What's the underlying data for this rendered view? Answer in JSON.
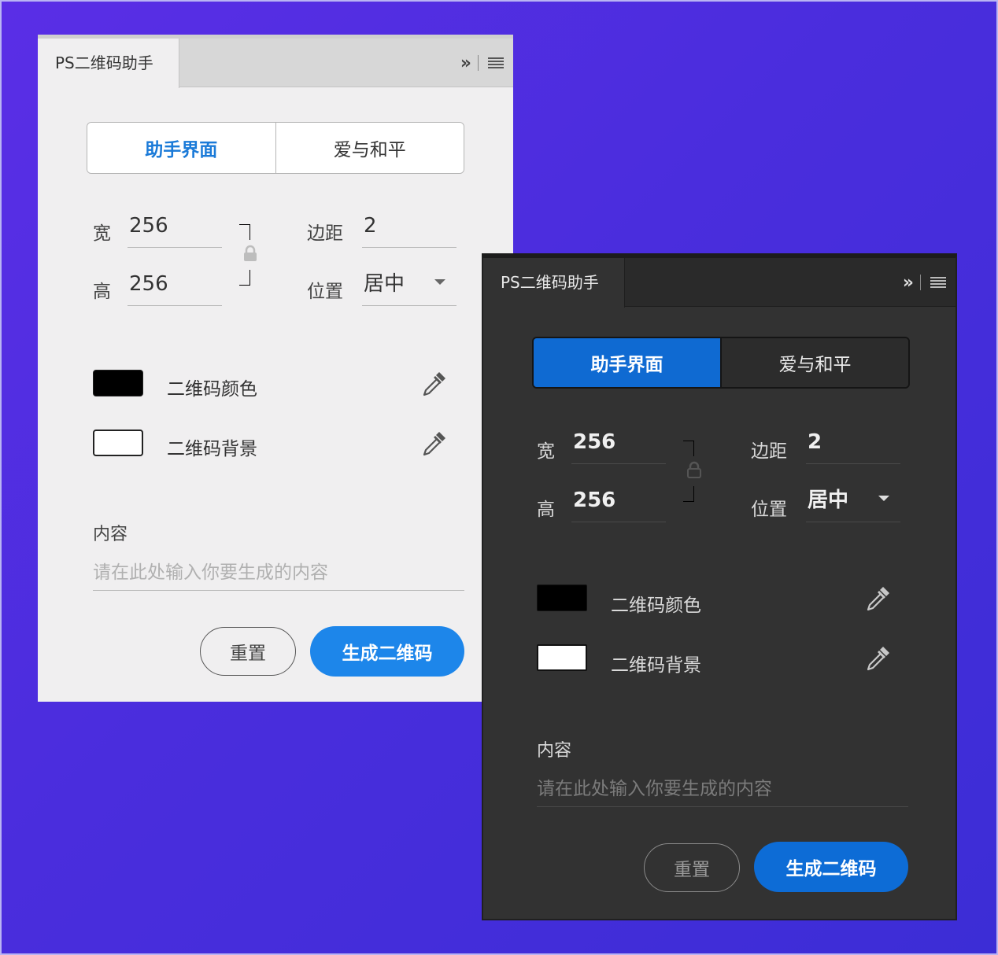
{
  "panels": {
    "light": {
      "tab_title": "PS二维码助手",
      "collapse_glyph": "››",
      "segment": {
        "active": "助手界面",
        "inactive": "爱与和平"
      },
      "width_label": "宽",
      "width_value": "256",
      "height_label": "高",
      "height_value": "256",
      "margin_label": "边距",
      "margin_value": "2",
      "position_label": "位置",
      "position_value": "居中",
      "color_label": "二维码颜色",
      "bg_label": "二维码背景",
      "content_label": "内容",
      "content_placeholder": "请在此处输入你要生成的内容",
      "reset_label": "重置",
      "generate_label": "生成二维码",
      "accent": "#1d86ea"
    },
    "dark": {
      "tab_title": "PS二维码助手",
      "collapse_glyph": "››",
      "segment": {
        "active": "助手界面",
        "inactive": "爱与和平"
      },
      "width_label": "宽",
      "width_value": "256",
      "height_label": "高",
      "height_value": "256",
      "margin_label": "边距",
      "margin_value": "2",
      "position_label": "位置",
      "position_value": "居中",
      "color_label": "二维码颜色",
      "bg_label": "二维码背景",
      "content_label": "内容",
      "content_placeholder": "请在此处输入你要生成的内容",
      "reset_label": "重置",
      "generate_label": "生成二维码",
      "accent": "#0d6cd6"
    }
  },
  "swatches": {
    "qr_color": "#000000",
    "qr_background": "#ffffff"
  },
  "icons": [
    "collapse-icon",
    "panel-menu-icon",
    "lock-icon",
    "eyedropper-icon",
    "dropdown-arrow-icon"
  ]
}
